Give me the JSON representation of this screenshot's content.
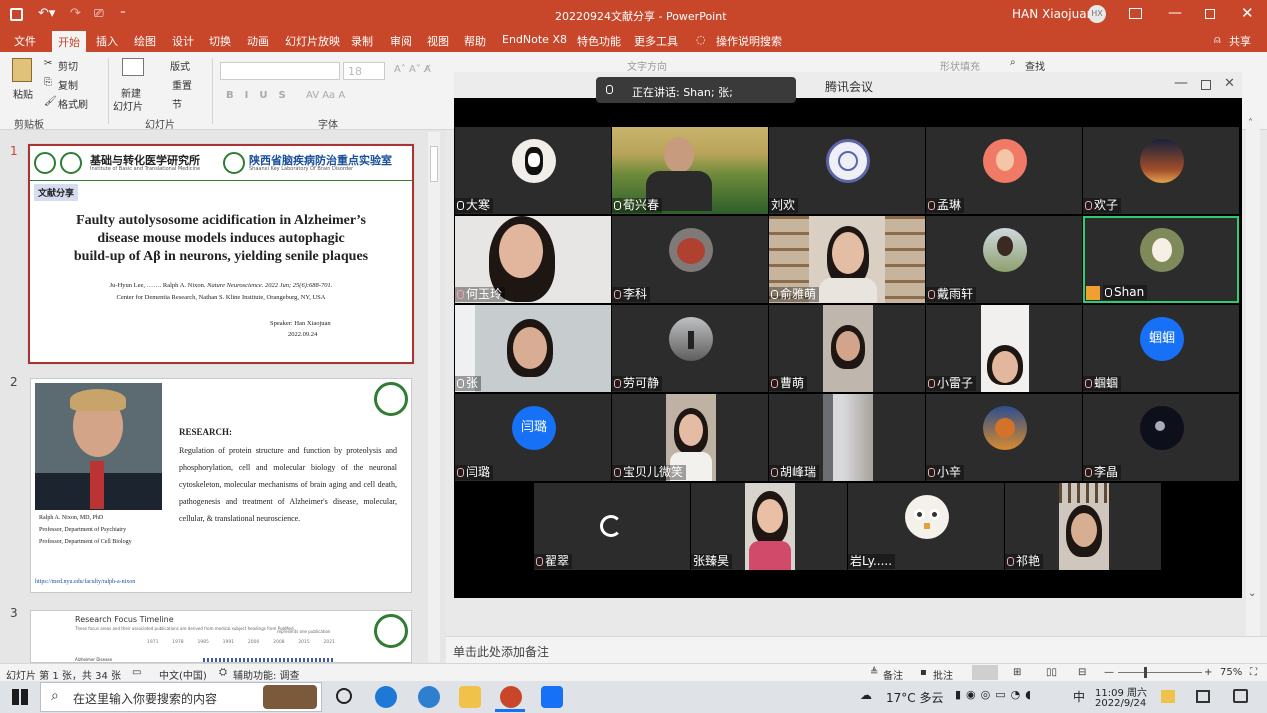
{
  "titlebar": {
    "doc_title": "20220924文献分享 - PowerPoint",
    "user": "HAN Xiaojuan",
    "user_initials": "HX"
  },
  "tabs": [
    "文件",
    "开始",
    "插入",
    "绘图",
    "设计",
    "切换",
    "动画",
    "幻灯片放映",
    "录制",
    "审阅",
    "视图",
    "帮助",
    "EndNote X8",
    "特色功能",
    "更多工具",
    "操作说明搜索"
  ],
  "share": "共享",
  "ribbon": {
    "paste": "粘贴",
    "cut": "剪切",
    "copy": "复制",
    "format_painter": "格式刷",
    "new_slide_1": "新建",
    "new_slide_2": "幻灯片",
    "layout": "版式",
    "reset": "重置",
    "section": "节",
    "font_size": "18",
    "text_direction": "文字方向",
    "shape_fill": "形状填充",
    "find": "查找",
    "groups": {
      "clipboard": "剪贴板",
      "slides": "幻灯片",
      "font": "字体"
    }
  },
  "slides": [
    {
      "num": "1",
      "logo_left": "基础与转化医学研究所",
      "logo_left_en": "Institute of Basic and Translational Medicine",
      "logo_right": "陕西省脑疾病防治重点实验室",
      "logo_right_en": "Shaanxi Key Laboratory Of Brain Disorder",
      "tag": "文献分享",
      "title_l1": "Faulty autolysosome acidification in Alzheimer’s",
      "title_l2": "disease mouse models induces autophagic",
      "title_l3": "build-up of Aβ in neurons, yielding senile plaques",
      "authors_plain": "Ju-Hyun Lee, ……. Ralph A. Nixon. ",
      "authors_cite": "Nature Neuroscience. 2022 Jun; 25(6):688-701.",
      "center": "Center for Dementia Research, Nathan S. Kline Institute, Orangeburg, NY, USA",
      "speaker": "Speaker: Han Xiaojuan",
      "date": "2022.09.24"
    },
    {
      "num": "2",
      "caption1": "Ralph A. Nixon, MD, PhD",
      "caption2": "Professor, Department of Psychiatry",
      "caption3": "Professor, Department of Cell Biology",
      "heading": "RESEARCH:",
      "body": "Regulation of protein structure and function by proteolysis and phosphorylation, cell and molecular biology of the neuronal cytoskeleton, molecular mechanisms of brain aging and cell death, pathogenesis and treatment of Alzheimer's disease, molecular, cellular, & translational neuroscience.",
      "url": "https://med.nyu.edu/faculty/ralph-a-nixon"
    },
    {
      "num": "3",
      "title": "Research Focus Timeline",
      "subtitle": "These focus areas and their associated publications are derived from medical subject headings from PubMed.",
      "legend": "represents one publication",
      "years": [
        "1971",
        "1978",
        "1985",
        "1991",
        "2000",
        "2008",
        "2015",
        "2021"
      ],
      "row_label": "Alzheimer Disease"
    }
  ],
  "meeting": {
    "title": "腾讯会议",
    "speaking": "正在讲话: Shan; 张;",
    "participants": [
      {
        "name": "大寒",
        "mic": "on"
      },
      {
        "name": "荀兴春",
        "mic": "on"
      },
      {
        "name": "刘欢",
        "mic": "none"
      },
      {
        "name": "孟琳",
        "mic": "off"
      },
      {
        "name": "欢子",
        "mic": "off"
      },
      {
        "name": "何玉玲",
        "mic": "off"
      },
      {
        "name": "李科",
        "mic": "off"
      },
      {
        "name": "俞雅萌",
        "mic": "on"
      },
      {
        "name": "戴雨轩",
        "mic": "off"
      },
      {
        "name": "Shan",
        "mic": "on"
      },
      {
        "name": "张",
        "mic": "on"
      },
      {
        "name": "劳可静",
        "mic": "off"
      },
      {
        "name": "曹萌",
        "mic": "off"
      },
      {
        "name": "小雷子",
        "mic": "off"
      },
      {
        "name": "蝈蝈",
        "mic": "off",
        "avatar_text": "蝈蝈"
      },
      {
        "name": "闫璐",
        "mic": "off",
        "avatar_text": "闫璐"
      },
      {
        "name": "宝贝儿微笑",
        "mic": "off"
      },
      {
        "name": "胡峰瑞",
        "mic": "off"
      },
      {
        "name": "小辛",
        "mic": "off"
      },
      {
        "name": "李晶",
        "mic": "off"
      },
      {
        "name": "翟翠",
        "mic": "off"
      },
      {
        "name": "张臻昊",
        "mic": "none"
      },
      {
        "name": "岩Ly.....",
        "mic": "none"
      },
      {
        "name": "祁艳",
        "mic": "off"
      }
    ]
  },
  "notes_placeholder": "单击此处添加备注",
  "status": {
    "slide": "幻灯片 第 1 张，共 34 张",
    "lang": "中文(中国)",
    "access": "辅助功能: 调查",
    "notes": "备注",
    "comments": "批注",
    "zoom": "75%"
  },
  "taskbar": {
    "search_placeholder": "在这里输入你要搜索的内容",
    "weather": "17°C 多云",
    "ime": "中",
    "time": "11:09 周六",
    "date": "2022/9/24"
  },
  "colors": {
    "accent": "#c8472b",
    "meeting_blue": "#1671f7",
    "active_speaker": "#2ecc71"
  }
}
